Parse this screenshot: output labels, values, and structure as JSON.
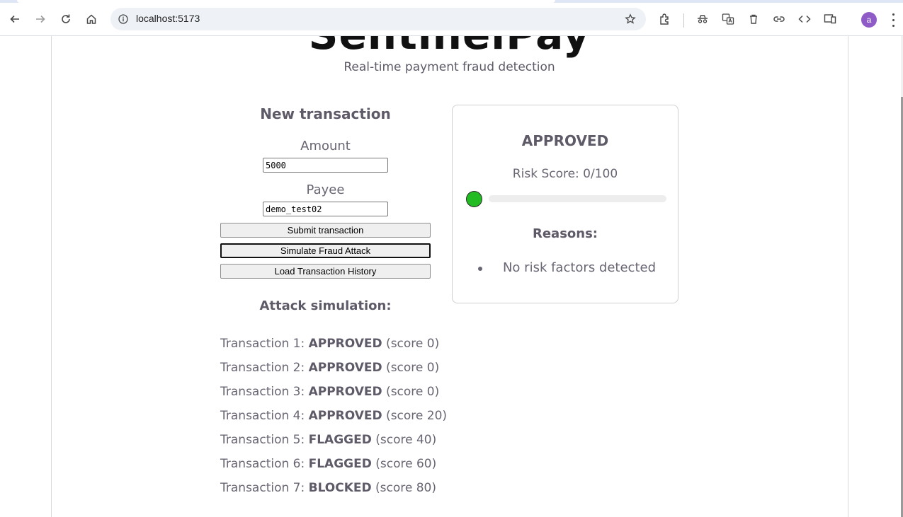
{
  "browser": {
    "url": "localhost:5173",
    "profile_initial": "a",
    "icons": [
      "back-icon",
      "forward-icon",
      "reload-icon",
      "home-icon",
      "site-info-icon",
      "bookmark-star-icon",
      "extensions-icon",
      "incognito-icon",
      "translate-icon",
      "trash-icon",
      "link-icon",
      "code-icon",
      "device-icon",
      "menu-icon"
    ]
  },
  "app": {
    "brand": "SentinelPay",
    "subtitle": "Real-time payment fraud detection"
  },
  "form": {
    "title": "New transaction",
    "amount_label": "Amount",
    "amount_value": "5000",
    "payee_label": "Payee",
    "payee_value": "demo_test02",
    "submit_label": "Submit transaction",
    "simulate_label": "Simulate Fraud Attack",
    "history_label": "Load Transaction History"
  },
  "attack": {
    "title": "Attack simulation:",
    "rows": [
      {
        "prefix": "Transaction 1: ",
        "status": "APPROVED",
        "suffix": " (score 0)"
      },
      {
        "prefix": "Transaction 2: ",
        "status": "APPROVED",
        "suffix": " (score 0)"
      },
      {
        "prefix": "Transaction 3: ",
        "status": "APPROVED",
        "suffix": " (score 0)"
      },
      {
        "prefix": "Transaction 4: ",
        "status": "APPROVED",
        "suffix": " (score 20)"
      },
      {
        "prefix": "Transaction 5: ",
        "status": "FLAGGED",
        "suffix": " (score 40)"
      },
      {
        "prefix": "Transaction 6: ",
        "status": "FLAGGED",
        "suffix": " (score 60)"
      },
      {
        "prefix": "Transaction 7: ",
        "status": "BLOCKED",
        "suffix": " (score 80)"
      }
    ]
  },
  "result": {
    "decision": "APPROVED",
    "risk_score_text": "Risk Score: 0/100",
    "risk_score_fraction": 0,
    "status_color": "#22bb22",
    "reasons_title": "Reasons:",
    "reasons": [
      "No risk factors detected"
    ]
  }
}
